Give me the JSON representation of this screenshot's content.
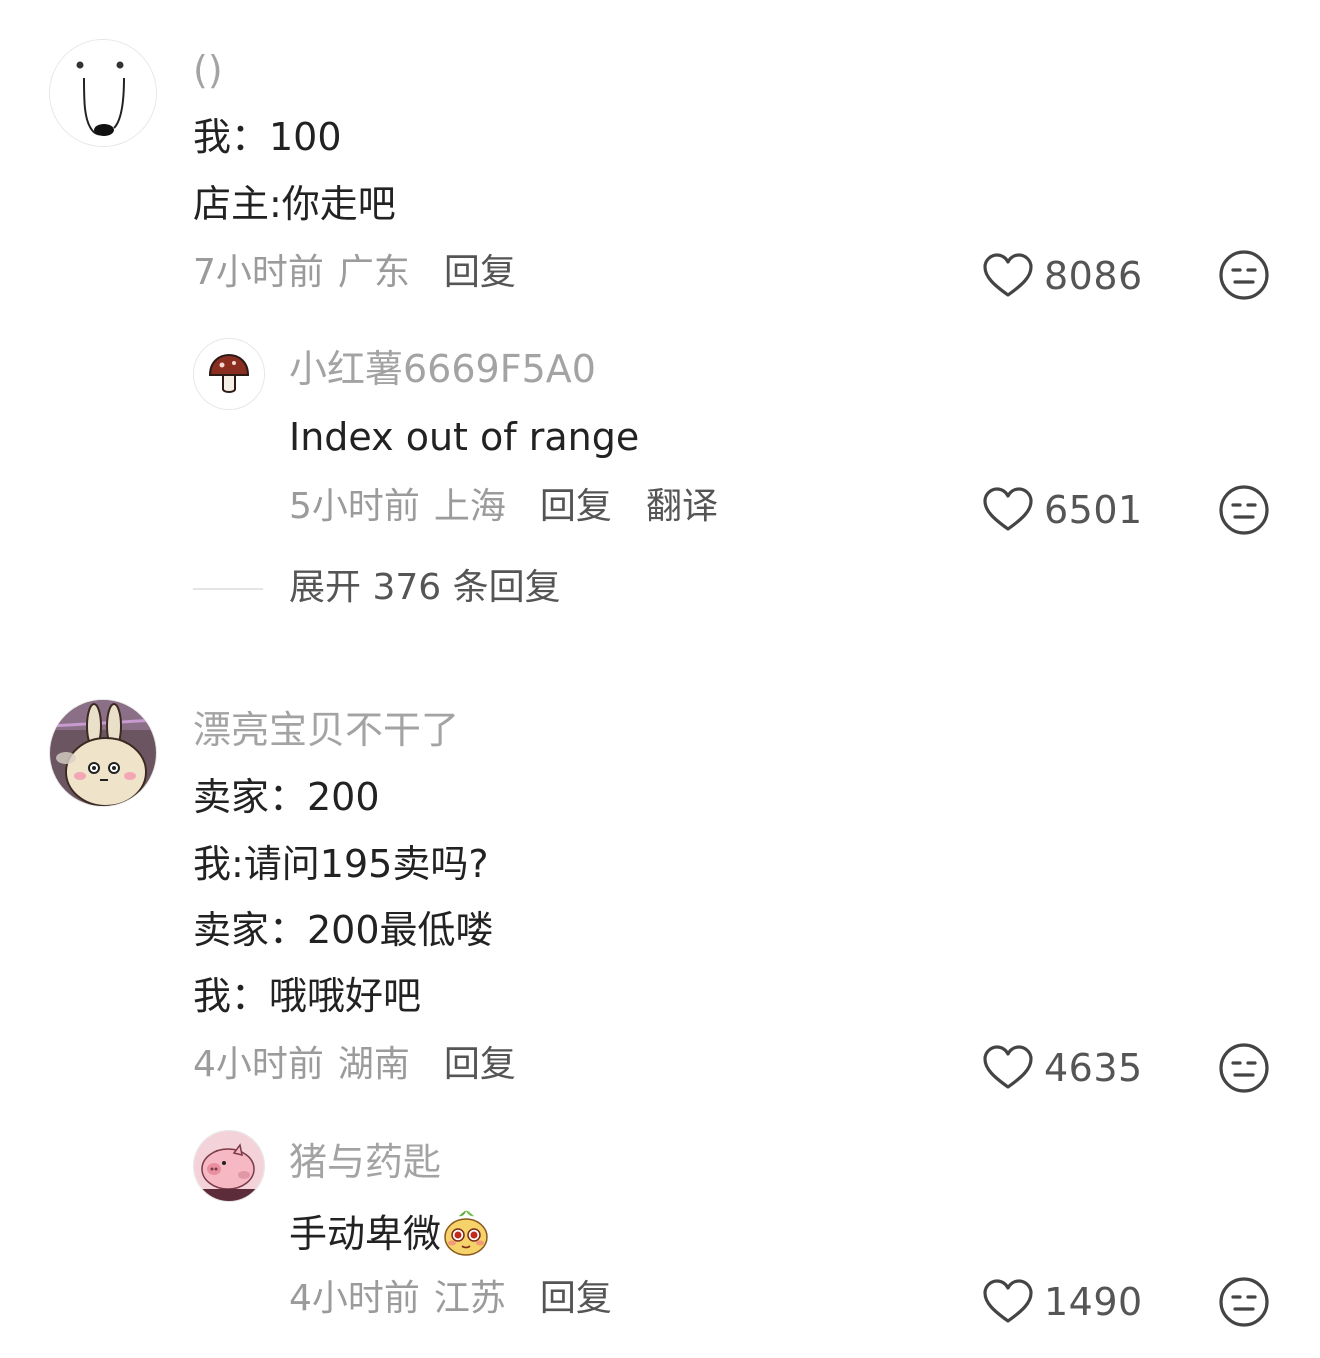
{
  "comments": [
    {
      "username": "()",
      "lines": [
        "我：100",
        "店主:你走吧"
      ],
      "time": "7小时前",
      "location": "广东",
      "reply_label": "回复",
      "likes": "8086",
      "avatar_icon": "face-sketch-avatar",
      "replies": [
        {
          "username": "小红薯6669F5A0",
          "text": "Index out of range",
          "time": "5小时前",
          "location": "上海",
          "reply_label": "回复",
          "translate_label": "翻译",
          "likes": "6501",
          "avatar_icon": "mushroom-avatar"
        }
      ],
      "expand_label": "展开 376 条回复"
    },
    {
      "username": "漂亮宝贝不干了",
      "lines": [
        "卖家：200",
        "我:请问195卖吗?",
        "卖家：200最低喽",
        "我：哦哦好吧"
      ],
      "time": "4小时前",
      "location": "湖南",
      "reply_label": "回复",
      "likes": "4635",
      "avatar_icon": "bunny-avatar",
      "replies": [
        {
          "username": "猪与药匙",
          "text": "手动卑微",
          "emoji": "pleading-face-emoji",
          "time": "4小时前",
          "location": "江苏",
          "reply_label": "回复",
          "likes": "1490",
          "avatar_icon": "pig-avatar"
        }
      ]
    }
  ],
  "colors": {
    "username": "#a3a3a3",
    "text": "#222222",
    "meta": "#9b9b9b",
    "action": "#555555",
    "divider": "#e4e4e4",
    "icon_stroke": "#444444"
  }
}
